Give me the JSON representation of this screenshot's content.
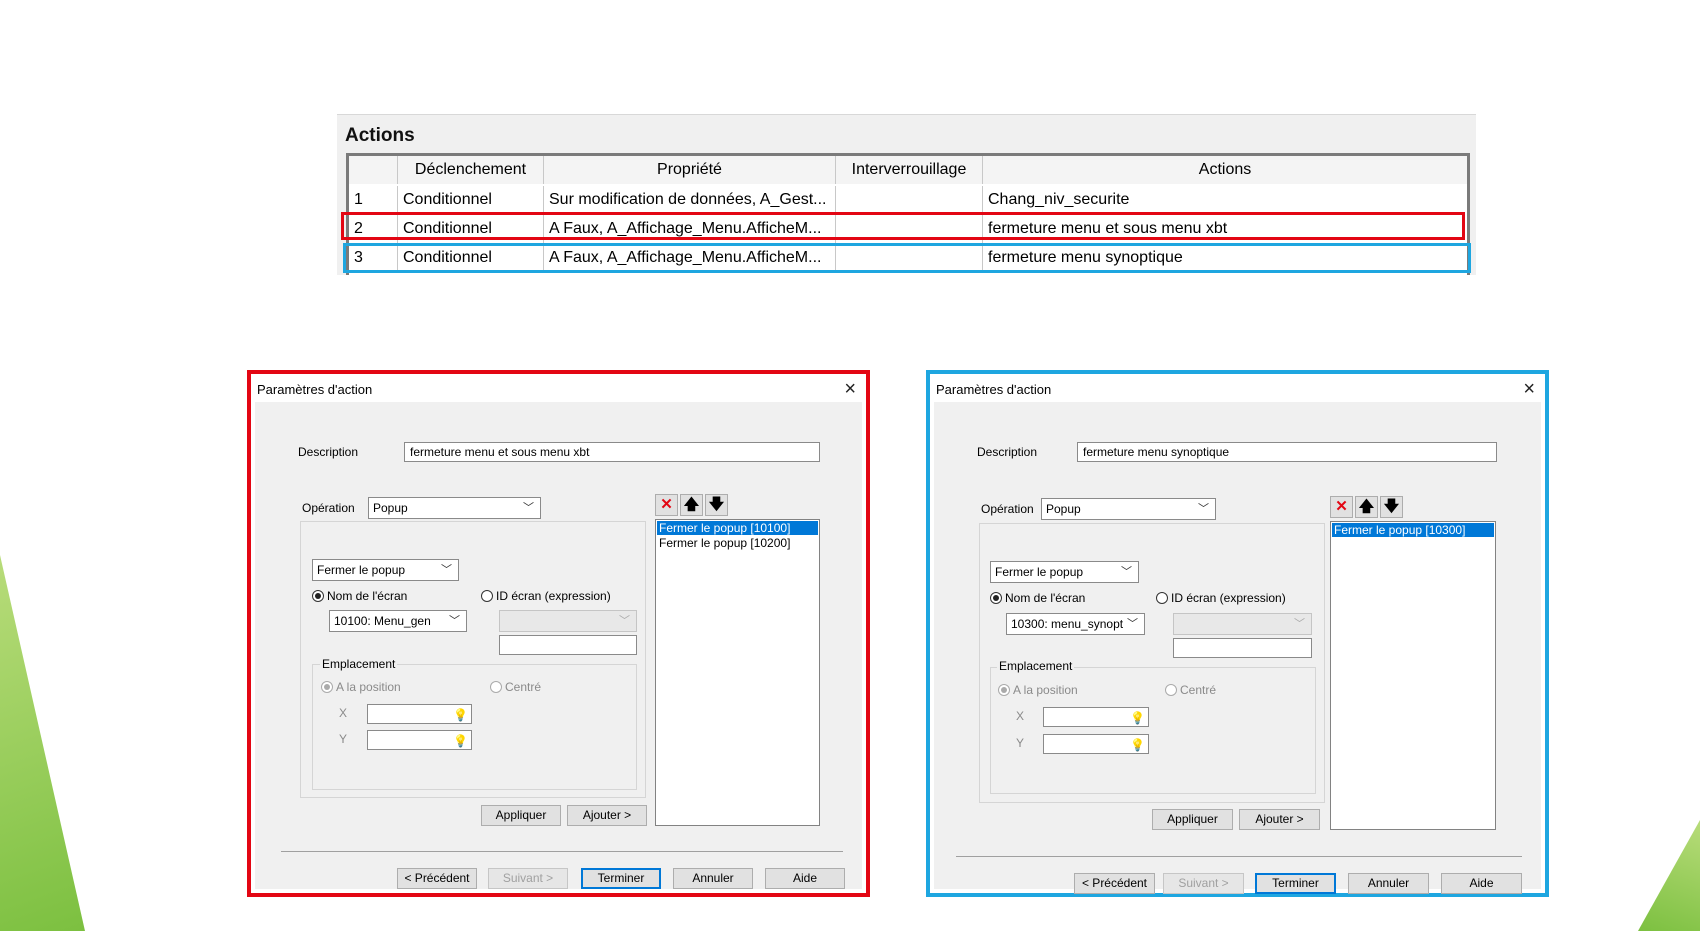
{
  "actions": {
    "title": "Actions",
    "columns": [
      "",
      "Déclenchement",
      "Propriété",
      "Interverrouillage",
      "Actions"
    ],
    "rows": [
      {
        "num": "1",
        "trigger": "Conditionnel",
        "property": "Sur modification de données, A_Gest...",
        "interlock": "",
        "action": "Chang_niv_securite"
      },
      {
        "num": "2",
        "trigger": "Conditionnel",
        "property": "A Faux, A_Affichage_Menu.AfficheM...",
        "interlock": "",
        "action": "fermeture menu et sous menu xbt"
      },
      {
        "num": "3",
        "trigger": "Conditionnel",
        "property": "A Faux, A_Affichage_Menu.AfficheM...",
        "interlock": "",
        "action": "fermeture menu synoptique"
      }
    ]
  },
  "highlight_colors": {
    "red": "#e30613",
    "blue": "#1ea6e0"
  },
  "dialog_common": {
    "title": "Paramètres d'action",
    "close_icon": "×",
    "description_label": "Description",
    "operation_label": "Opération",
    "operation_value": "Popup",
    "sub_operation_value": "Fermer le popup",
    "screen_name_label": "Nom de l'écran",
    "screen_id_label": "ID écran (expression)",
    "location_label": "Emplacement",
    "at_position_label": "A la position",
    "centered_label": "Centré",
    "x_label": "X",
    "y_label": "Y",
    "apply_label": "Appliquer",
    "add_label": "Ajouter >",
    "prev_label": "< Précédent",
    "next_label": "Suivant >",
    "finish_label": "Terminer",
    "cancel_label": "Annuler",
    "help_label": "Aide",
    "delete_icon": "✕",
    "up_icon": "🡅",
    "down_icon": "🡇",
    "bulb_icon": "💡"
  },
  "dialog_left": {
    "description": "fermeture menu et sous menu xbt",
    "screen": "10100: Menu_gen",
    "list": [
      "Fermer le popup [10100]",
      "Fermer le popup [10200]"
    ]
  },
  "dialog_right": {
    "description": "fermeture menu synoptique",
    "screen": "10300: menu_synopt",
    "list": [
      "Fermer le popup [10300]"
    ]
  }
}
